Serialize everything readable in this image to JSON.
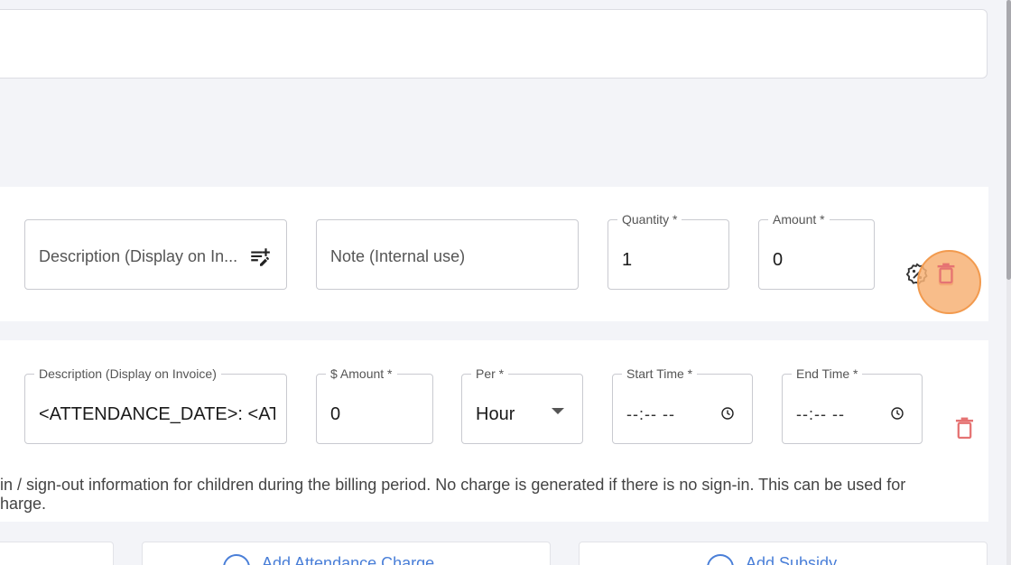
{
  "colors": {
    "accent": "#4a7fd8",
    "delete": "#e57373",
    "highlight": "#f7b276"
  },
  "row1": {
    "description_placeholder": "Description (Display on In...",
    "note_placeholder": "Note (Internal use)",
    "quantity_label": "Quantity *",
    "quantity_value": "1",
    "amount_label": "Amount *",
    "amount_value": "0",
    "icons": [
      "note-add-icon",
      "discount-icon",
      "delete-icon"
    ]
  },
  "row2": {
    "description_label": "Description (Display on Invoice)",
    "description_value": "<ATTENDANCE_DATE>: <ATT",
    "amount_label": "$ Amount *",
    "amount_value": "0",
    "per_label": "Per *",
    "per_value": "Hour",
    "start_label": "Start Time *",
    "start_value": "--:-- --",
    "end_label": "End Time *",
    "end_value": "--:-- --",
    "icons": [
      "clock-icon",
      "chevron-down-icon",
      "delete-icon"
    ]
  },
  "info_text_line1": "in / sign-out information for children during the billing period. No charge is generated if there is no sign-in. This can be used for",
  "info_text_line2": "harge.",
  "buttons": {
    "add_attendance": "Add Attendance Charge",
    "add_subsidy": "Add Subsidy"
  }
}
